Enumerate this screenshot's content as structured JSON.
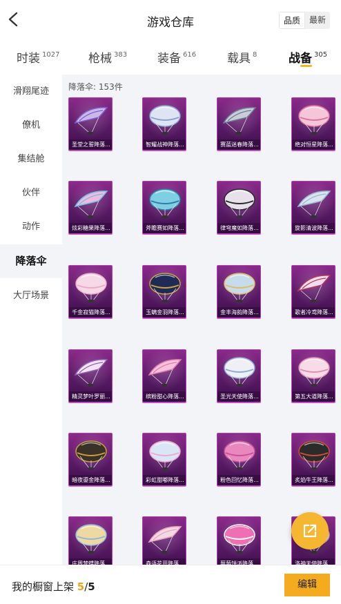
{
  "header": {
    "title": "游戏仓库",
    "sort_options": [
      "品质",
      "最新"
    ],
    "sort_selected": "品质"
  },
  "tabs": [
    {
      "label": "时装",
      "count": "1027"
    },
    {
      "label": "枪械",
      "count": "383"
    },
    {
      "label": "装备",
      "count": "616"
    },
    {
      "label": "载具",
      "count": "8"
    },
    {
      "label": "战备",
      "count": "305",
      "active": true
    }
  ],
  "sidebar": {
    "items": [
      {
        "label": "滑翔尾迹"
      },
      {
        "label": "僚机"
      },
      {
        "label": "集结舱"
      },
      {
        "label": "伙伴"
      },
      {
        "label": "动作"
      },
      {
        "label": "降落伞",
        "active": true
      },
      {
        "label": "大厅场景"
      }
    ]
  },
  "main": {
    "count_label": "降落伞: 153件",
    "items": [
      {
        "name": "圣堂之誓降落...",
        "kind": "wing",
        "canopy": "#c9b8e8",
        "accent": "#7c5fd0"
      },
      {
        "name": "智耀战神降落...",
        "kind": "dome",
        "canopy": "#dfe4f2",
        "accent": "#8aa0d6"
      },
      {
        "name": "赛蓝迷春降落...",
        "kind": "wing",
        "canopy": "#c9cdd8",
        "accent": "#6d7a95"
      },
      {
        "name": "绝对恒星降落...",
        "kind": "dome",
        "canopy": "#f4c6d8",
        "accent": "#e0709f"
      },
      {
        "name": "炫彩糖果降落...",
        "kind": "wing",
        "canopy": "#f2b8de",
        "accent": "#62c3e6"
      },
      {
        "name": "斧瞻赛如降落...",
        "kind": "dome",
        "canopy": "#7fcfe4",
        "accent": "#2e7fa5"
      },
      {
        "name": "律穹魔如降落...",
        "kind": "dome",
        "canopy": "#e6e1ea",
        "accent": "#2a2a2a"
      },
      {
        "name": "旋影清波降落...",
        "kind": "wing",
        "canopy": "#d9e4ef",
        "accent": "#9bb4cc"
      },
      {
        "name": "千金寂猫降落...",
        "kind": "dome",
        "canopy": "#f6d9e7",
        "accent": "#f0a8c8"
      },
      {
        "name": "玉螭金羽降落...",
        "kind": "dome",
        "canopy": "#1f2a55",
        "accent": "#c9a34a"
      },
      {
        "name": "金丰海韵降落...",
        "kind": "dome",
        "canopy": "#c6dcea",
        "accent": "#e0bc66"
      },
      {
        "name": "歌者冷鸢降落...",
        "kind": "wing",
        "canopy": "#f0dcec",
        "accent": "#b43a5a"
      },
      {
        "name": "精灵梦叶罗丽...",
        "kind": "wing",
        "canopy": "#f2e4f2",
        "accent": "#8f60b5"
      },
      {
        "name": "缤粉甜心降落...",
        "kind": "wing",
        "canopy": "#f6c2dc",
        "accent": "#e07aab"
      },
      {
        "name": "圣光天使降落...",
        "kind": "dome",
        "canopy": "#eef0f6",
        "accent": "#8fa8d8"
      },
      {
        "name": "第五大道降落...",
        "kind": "dome",
        "canopy": "#f7dbe6",
        "accent": "#e58cb0"
      },
      {
        "name": "暗夜鎏金降落...",
        "kind": "dome",
        "canopy": "#3a3227",
        "accent": "#c99e3e"
      },
      {
        "name": "彩虹甜嘟降落...",
        "kind": "dome",
        "canopy": "#d9e6f5",
        "accent": "#f2a8cf"
      },
      {
        "name": "粉色回忆降落...",
        "kind": "dome",
        "canopy": "#e987bf",
        "accent": "#c75296"
      },
      {
        "name": "炙焰牛王降落...",
        "kind": "dome",
        "canopy": "#2b2b2b",
        "accent": "#d24a3a"
      },
      {
        "name": "庄周梦蝶降落...",
        "kind": "dome",
        "canopy": "#eed9a2",
        "accent": "#8fb7d9"
      },
      {
        "name": "森语花开降落...",
        "kind": "wing",
        "canopy": "#f3d9e2",
        "accent": "#e8a3c0"
      },
      {
        "name": "莓莓饼派降落...",
        "kind": "dome",
        "canopy": "#ee6fb3",
        "accent": "#ffffff"
      },
      {
        "name": "洛神天使降落...",
        "kind": "dome",
        "canopy": "#f4e6c8",
        "accent": "#d9a2c5"
      }
    ]
  },
  "float_button": {
    "icon": "share-icon"
  },
  "bottom_bar": {
    "label": "我的橱窗上架",
    "current": "5",
    "sep": "/",
    "total": "5",
    "edit_label": "编辑"
  }
}
